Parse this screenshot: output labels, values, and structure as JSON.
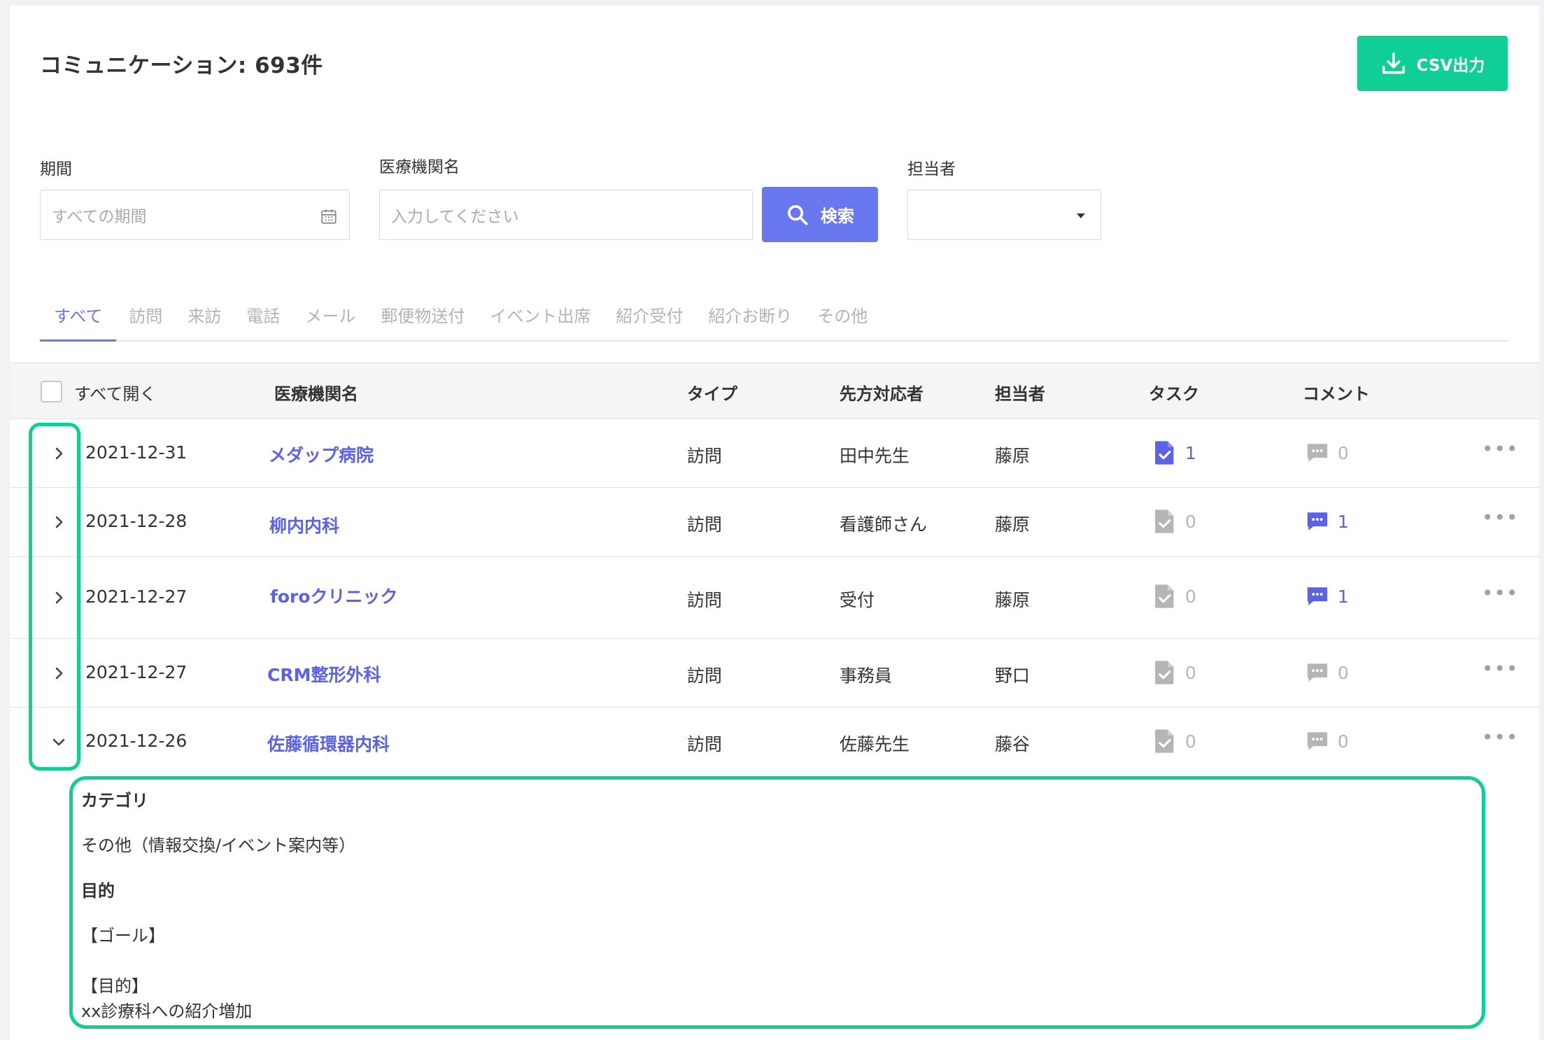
{
  "header": {
    "title": "コミュニケーション: 693件",
    "csv_button_label": "CSV出力"
  },
  "filters": {
    "period_label": "期間",
    "period_placeholder": "すべての期間",
    "facility_label": "医療機関名",
    "facility_placeholder": "入力してください",
    "search_button_label": "検索",
    "staff_label": "担当者",
    "staff_value": ""
  },
  "tabs": [
    {
      "label": "すべて"
    },
    {
      "label": "訪問"
    },
    {
      "label": "来訪"
    },
    {
      "label": "電話"
    },
    {
      "label": "メール"
    },
    {
      "label": "郵便物送付"
    },
    {
      "label": "イベント出席"
    },
    {
      "label": "紹介受付"
    },
    {
      "label": "紹介お断り"
    },
    {
      "label": "その他"
    }
  ],
  "active_tab": "すべて",
  "table": {
    "expand_all_label": "すべて開く",
    "columns": {
      "facility": "医療機関名",
      "type": "タイプ",
      "contact": "先方対応者",
      "staff": "担当者",
      "task": "タスク",
      "comment": "コメント"
    },
    "rows": [
      {
        "date": "2021-12-31",
        "facility": "メダップ病院",
        "type": "訪問",
        "contact": "田中先生",
        "staff": "藤原",
        "task_count": "1",
        "comment_count": "0",
        "expanded": false
      },
      {
        "date": "2021-12-28",
        "facility": "柳内内科",
        "type": "訪問",
        "contact": "看護師さん",
        "staff": "藤原",
        "task_count": "0",
        "comment_count": "1",
        "expanded": false
      },
      {
        "date": "2021-12-27",
        "facility": "foroクリニック",
        "type": "訪問",
        "contact": "受付",
        "staff": "藤原",
        "task_count": "0",
        "comment_count": "1",
        "expanded": false
      },
      {
        "date": "2021-12-27",
        "facility": "CRM整形外科",
        "type": "訪問",
        "contact": "事務員",
        "staff": "野口",
        "task_count": "0",
        "comment_count": "0",
        "expanded": false
      },
      {
        "date": "2021-12-26",
        "facility": "佐藤循環器内科",
        "type": "訪問",
        "contact": "佐藤先生",
        "staff": "藤谷",
        "task_count": "0",
        "comment_count": "0",
        "expanded": true
      }
    ],
    "more_label": "•••"
  },
  "detail": {
    "category_heading": "カテゴリ",
    "category_value": "その他（情報交換/イベント案内等）",
    "purpose_heading": "目的",
    "goal_label": "【ゴール】",
    "purpose_label": "【目的】",
    "purpose_value": "xx診療科への紹介増加"
  },
  "colors": {
    "accent": "#6a78f0",
    "link": "#5b62e6",
    "csv_button": "#0fcf97",
    "highlight": "#0fcf97",
    "muted_icon": "#b5b5b8"
  },
  "icons": {
    "csv": "download-icon",
    "period": "calendar-icon",
    "search": "search-icon",
    "staff": "caret-down-icon",
    "row_collapsed": "chevron-right-icon",
    "row_expanded": "chevron-down-icon",
    "task": "task-document-icon",
    "comment": "comment-bubble-icon",
    "more": "more-horizontal-icon"
  }
}
